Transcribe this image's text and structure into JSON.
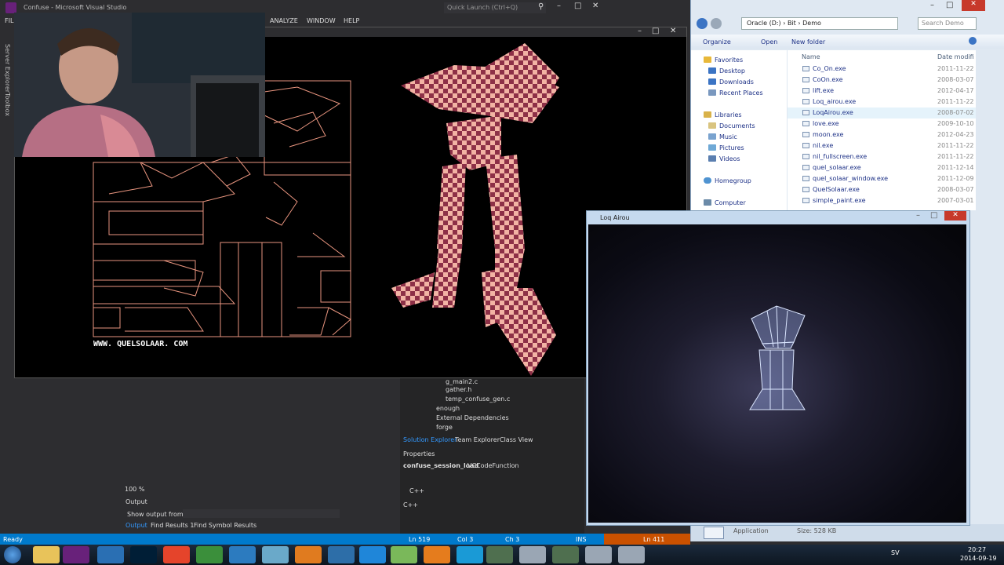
{
  "vs": {
    "title": "Confuse - Microsoft Visual Studio",
    "menu": [
      "FIL",
      "ANALYZE",
      "WINDOW",
      "HELP"
    ],
    "quick_launch": "Quick Launch (Ctrl+Q)",
    "side_tabs": [
      "Server Explorer",
      "Toolbox"
    ],
    "watermark": "WWW. QUELSOLAAR. COM",
    "zoom": "100 %",
    "output": {
      "title": "Output",
      "show_from": "Show output from:",
      "tabs": [
        "Output",
        "Find Results 1",
        "Find Symbol Results"
      ]
    },
    "solution": {
      "items": [
        "g_main2.c",
        "gather.h",
        "temp_confuse_gen.c",
        "enough",
        "External Dependencies",
        "forge"
      ],
      "tabs": [
        "Solution Explorer",
        "Team Explorer",
        "Class View"
      ]
    },
    "properties": {
      "title": "Properties",
      "object": "confuse_session_load",
      "type": "VCCodeFunction",
      "section": "C++",
      "value": "C++"
    },
    "status": {
      "state": "Ready",
      "ln": "Ln 519",
      "col": "Col 3",
      "ch": "Ch 3",
      "ins": "INS",
      "ln2": "Ln 411"
    }
  },
  "explorer": {
    "path": [
      "Oracle (D:)",
      "Bit",
      "Demo"
    ],
    "search": "Search Demo",
    "commands": [
      "Organize",
      "Open",
      "New folder"
    ],
    "columns": [
      "Name",
      "Date modifi"
    ],
    "nav": [
      "Favorites",
      "Desktop",
      "Downloads",
      "Recent Places",
      "Libraries",
      "Documents",
      "Music",
      "Pictures",
      "Videos",
      "Homegroup",
      "Computer"
    ],
    "files": [
      {
        "name": "Co_On.exe",
        "date": "2011-11-22"
      },
      {
        "name": "CoOn.exe",
        "date": "2008-03-07"
      },
      {
        "name": "lift.exe",
        "date": "2012-04-17"
      },
      {
        "name": "Loq_airou.exe",
        "date": "2011-11-22"
      },
      {
        "name": "LoqAirou.exe",
        "date": "2008-07-02"
      },
      {
        "name": "love.exe",
        "date": "2009-10-10"
      },
      {
        "name": "moon.exe",
        "date": "2012-04-23"
      },
      {
        "name": "nil.exe",
        "date": "2011-11-22"
      },
      {
        "name": "nil_fullscreen.exe",
        "date": "2011-11-22"
      },
      {
        "name": "quel_solaar.exe",
        "date": "2011-12-14"
      },
      {
        "name": "quel_solaar_window.exe",
        "date": "2011-12-09"
      },
      {
        "name": "QuelSolaar.exe",
        "date": "2008-03-07"
      },
      {
        "name": "simple_paint.exe",
        "date": "2007-03-01"
      }
    ],
    "status_type": "Application",
    "status_size": "Size: 528 KB"
  },
  "loq": {
    "title": "Loq Airou"
  },
  "taskbar": {
    "lang": "SV",
    "time": "20:27",
    "date": "2014-09-19"
  }
}
